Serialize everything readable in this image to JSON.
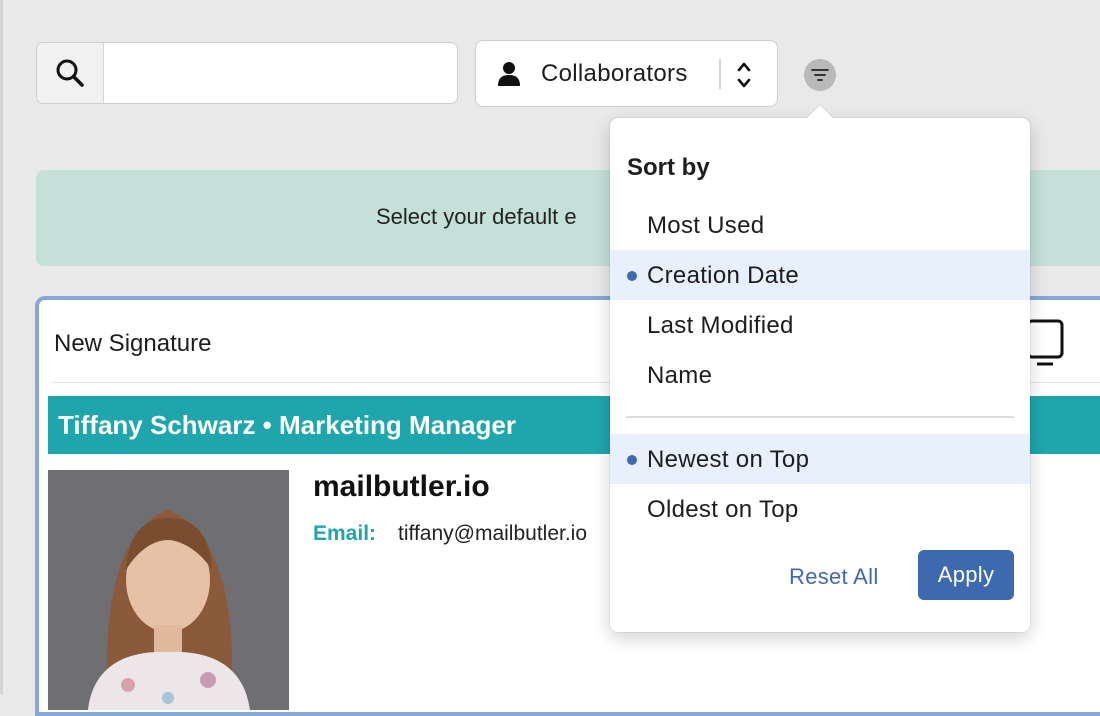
{
  "search": {
    "value": "",
    "placeholder": ""
  },
  "collaborators": {
    "selected": "Collaborators"
  },
  "banner": {
    "text": "Select your default e"
  },
  "signature": {
    "name": "New Signature",
    "header": "Tiffany Schwarz • Marketing Manager",
    "domain": "mailbutler.io",
    "email_label": "Email:",
    "email_value": "tiffany@mailbutler.io"
  },
  "sort_popover": {
    "title": "Sort by",
    "sort_options": [
      {
        "label": "Most Used",
        "selected": false
      },
      {
        "label": "Creation Date",
        "selected": true
      },
      {
        "label": "Last Modified",
        "selected": false
      },
      {
        "label": "Name",
        "selected": false
      }
    ],
    "order_options": [
      {
        "label": "Newest on Top",
        "selected": true
      },
      {
        "label": "Oldest on Top",
        "selected": false
      }
    ],
    "reset_label": "Reset All",
    "apply_label": "Apply"
  },
  "colors": {
    "accent": "#3d69ae",
    "teal": "#1fa6ad",
    "banner": "#c4e0d9",
    "selected_row": "#e8f0fc"
  }
}
